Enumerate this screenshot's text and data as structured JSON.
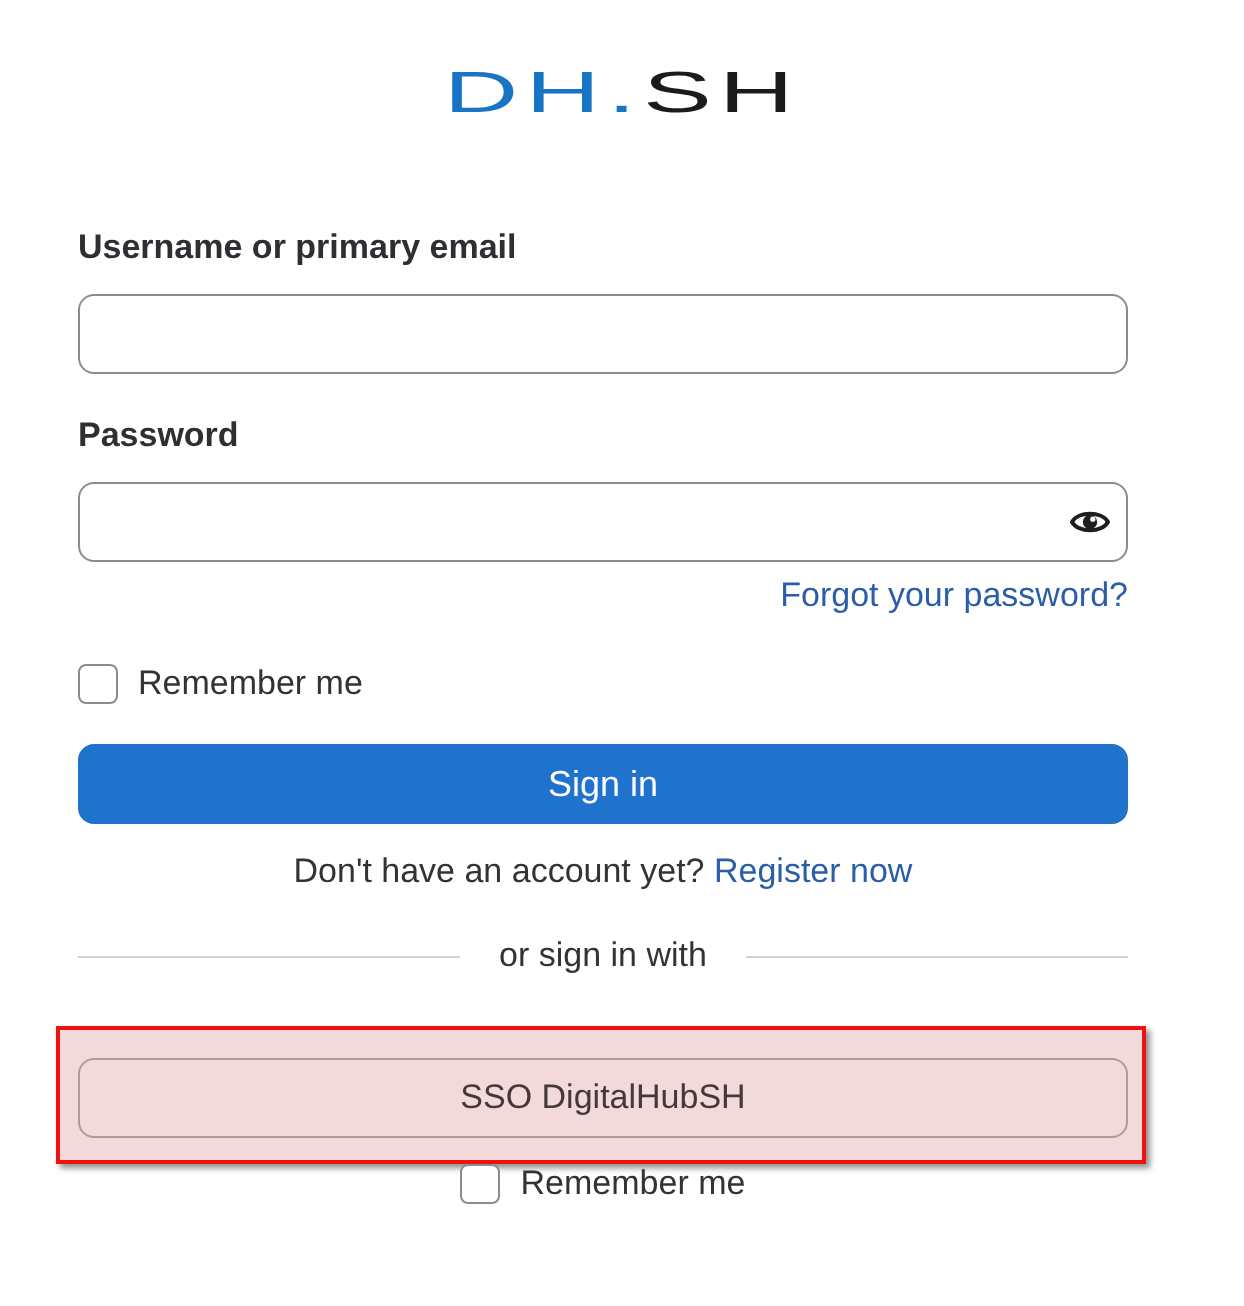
{
  "logo": {
    "primary": "DH.",
    "secondary": "SH"
  },
  "fields": [
    {
      "kind": "text",
      "label": "Username or primary email"
    },
    {
      "kind": "password",
      "label": "Password"
    }
  ],
  "forgot_link": "Forgot your password?",
  "remember": {
    "label": "Remember me",
    "checked": false
  },
  "submit": "Sign in",
  "register": {
    "prompt": "Don't have an account yet?",
    "link": "Register now"
  },
  "divider": "or sign in with",
  "providers": [
    {
      "label": "SSO DigitalHubSH",
      "highlighted": true
    }
  ],
  "provider_remember": {
    "label": "Remember me",
    "checked": false
  }
}
